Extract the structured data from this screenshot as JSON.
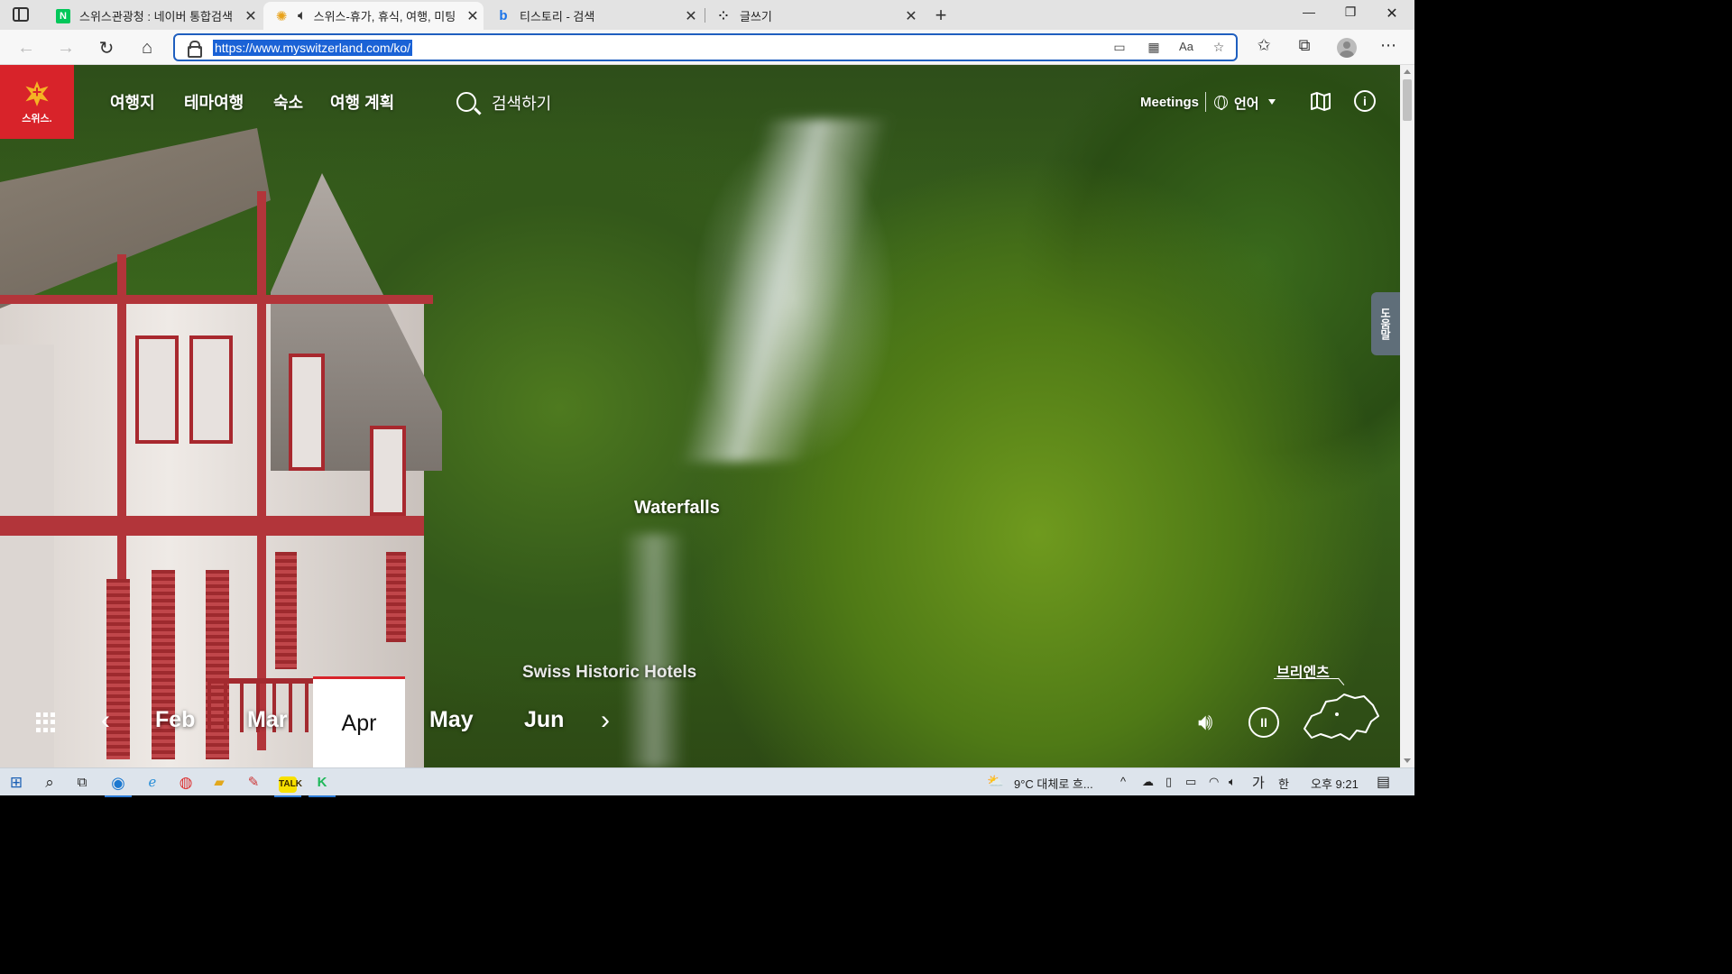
{
  "browser": {
    "tabs": [
      {
        "title": "스위스관광청 : 네이버 통합검색",
        "favicon": "naver-icon",
        "favicon_text": "N",
        "favicon_color": "#03c75a",
        "active": false
      },
      {
        "title": "스위스-휴가, 휴식, 여행, 미팅",
        "favicon": "sun-icon",
        "active": true,
        "audio": true
      },
      {
        "title": "티스토리 - 검색",
        "favicon": "bing-icon",
        "active": false
      },
      {
        "title": "글쓰기",
        "favicon": "tistory-icon",
        "active": false
      }
    ],
    "url": "https://www.myswitzerland.com/ko/"
  },
  "site": {
    "logo_text": "스위스.",
    "brand_color": "#d8232a",
    "nav": [
      "여행지",
      "테마여행",
      "숙소",
      "여행 계획"
    ],
    "search_label": "검색하기",
    "meetings": "Meetings",
    "language": "언어",
    "help_tab": "도움말",
    "captions": {
      "main": "Waterfalls",
      "secondary": "Swiss Historic Hotels"
    },
    "months": {
      "items": [
        "Feb",
        "Mar",
        "Apr",
        "May",
        "Jun"
      ],
      "selected": "Apr"
    },
    "location": "브리엔츠"
  },
  "taskbar": {
    "weather": "9°C  대체로 흐...",
    "ime": "가",
    "ime2": "한",
    "time": "오후 9:21"
  }
}
